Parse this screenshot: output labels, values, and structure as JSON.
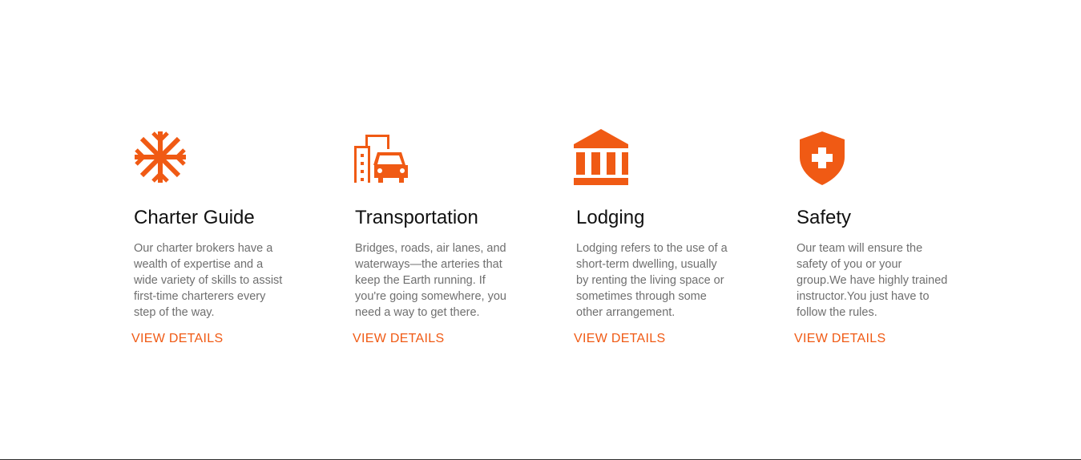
{
  "colors": {
    "accent": "#f05a14",
    "title": "#111111",
    "text": "#6f6f6f"
  },
  "features": [
    {
      "icon": "snowflake-icon",
      "title": "Charter Guide",
      "description": "Our charter brokers have a wealth of expertise and a wide variety of skills to assist first-time charterers every step of the way.",
      "link": "VIEW DETAILS"
    },
    {
      "icon": "city-car-icon",
      "title": "Transportation",
      "description": "Bridges, roads, air lanes, and waterways—the arteries that keep the Earth running. If you're going somewhere, you need a way to get there.",
      "link": "VIEW DETAILS"
    },
    {
      "icon": "bank-building-icon",
      "title": "Lodging",
      "description": "Lodging refers to the use of a short-term dwelling, usually by renting the living space or sometimes through some other arrangement.",
      "link": "VIEW DETAILS"
    },
    {
      "icon": "shield-plus-icon",
      "title": "Safety",
      "description": "Our team will ensure the safety of you or your group.We have highly trained instructor.You just have to follow the rules.",
      "link": "VIEW DETAILS"
    }
  ]
}
